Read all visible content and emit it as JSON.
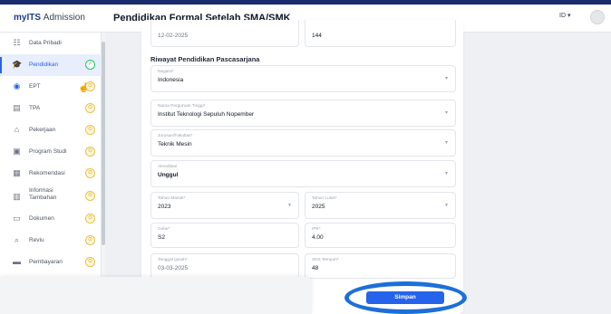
{
  "header": {
    "logo_brand": "myITS",
    "logo_app": "Admission",
    "page_title": "Pendidikan Formal Setelah SMA/SMK",
    "language": "ID ▾"
  },
  "sidebar": {
    "items": [
      {
        "label": "Data Pribadi",
        "icon": "list-icon",
        "glyph": "☷",
        "status": ""
      },
      {
        "label": "Pendidikan",
        "icon": "graduation-cap-icon",
        "glyph": "🎓",
        "status": "✓"
      },
      {
        "label": "EPT",
        "icon": "globe-icon",
        "glyph": "◉",
        "status": "⊙"
      },
      {
        "label": "TPA",
        "icon": "document-icon",
        "glyph": "▤",
        "status": "⊙"
      },
      {
        "label": "Pekerjaan",
        "icon": "briefcase-icon",
        "glyph": "⌂",
        "status": "⊙"
      },
      {
        "label": "Program Studi",
        "icon": "program-icon",
        "glyph": "▣",
        "status": "⊙"
      },
      {
        "label": "Rekomendasi",
        "icon": "recommendation-icon",
        "glyph": "▦",
        "status": "⊙"
      },
      {
        "label": "Informasi Tambahan",
        "icon": "info-doc-icon",
        "glyph": "▥",
        "status": "⊙"
      },
      {
        "label": "Dokumen",
        "icon": "folder-icon",
        "glyph": "▭",
        "status": "⊙"
      },
      {
        "label": "Reviu",
        "icon": "magnifier-icon",
        "glyph": "⌕",
        "status": "⊙"
      },
      {
        "label": "Pembayaran",
        "icon": "card-icon",
        "glyph": "▬",
        "status": "⊙"
      }
    ]
  },
  "form": {
    "top_date_value": "12-02-2025",
    "top_number_value": "144",
    "section_title": "Riwayat Pendidikan Pascasarjana",
    "negara": {
      "label": "Negara*",
      "value": "Indonesia"
    },
    "perguruan": {
      "label": "Nama Perguruan Tinggi*",
      "value": "Institut Teknologi Sepuluh Nopember"
    },
    "jurusan": {
      "label": "Jurusan/Fakultas*",
      "value": "Teknik Mesin"
    },
    "akreditasi": {
      "label": "Akreditasi",
      "value": "Unggul"
    },
    "tahun_masuk": {
      "label": "Tahun Masuk*",
      "value": "2023"
    },
    "tahun_lulus": {
      "label": "Tahun Lulus*",
      "value": "2025"
    },
    "gelar": {
      "label": "Gelar*",
      "value": "S2"
    },
    "ipk": {
      "label": "IPK*",
      "value": "4.00"
    },
    "tanggal_ijazah": {
      "label": "Tanggal Ijazah*",
      "value": "03-03-2025"
    },
    "sks": {
      "label": "SKS Tempuh*",
      "value": "48"
    }
  },
  "actions": {
    "save_label": "Simpan"
  },
  "colors": {
    "accent": "#2563eb",
    "pending": "#e8c14a",
    "done": "#22c55e"
  }
}
